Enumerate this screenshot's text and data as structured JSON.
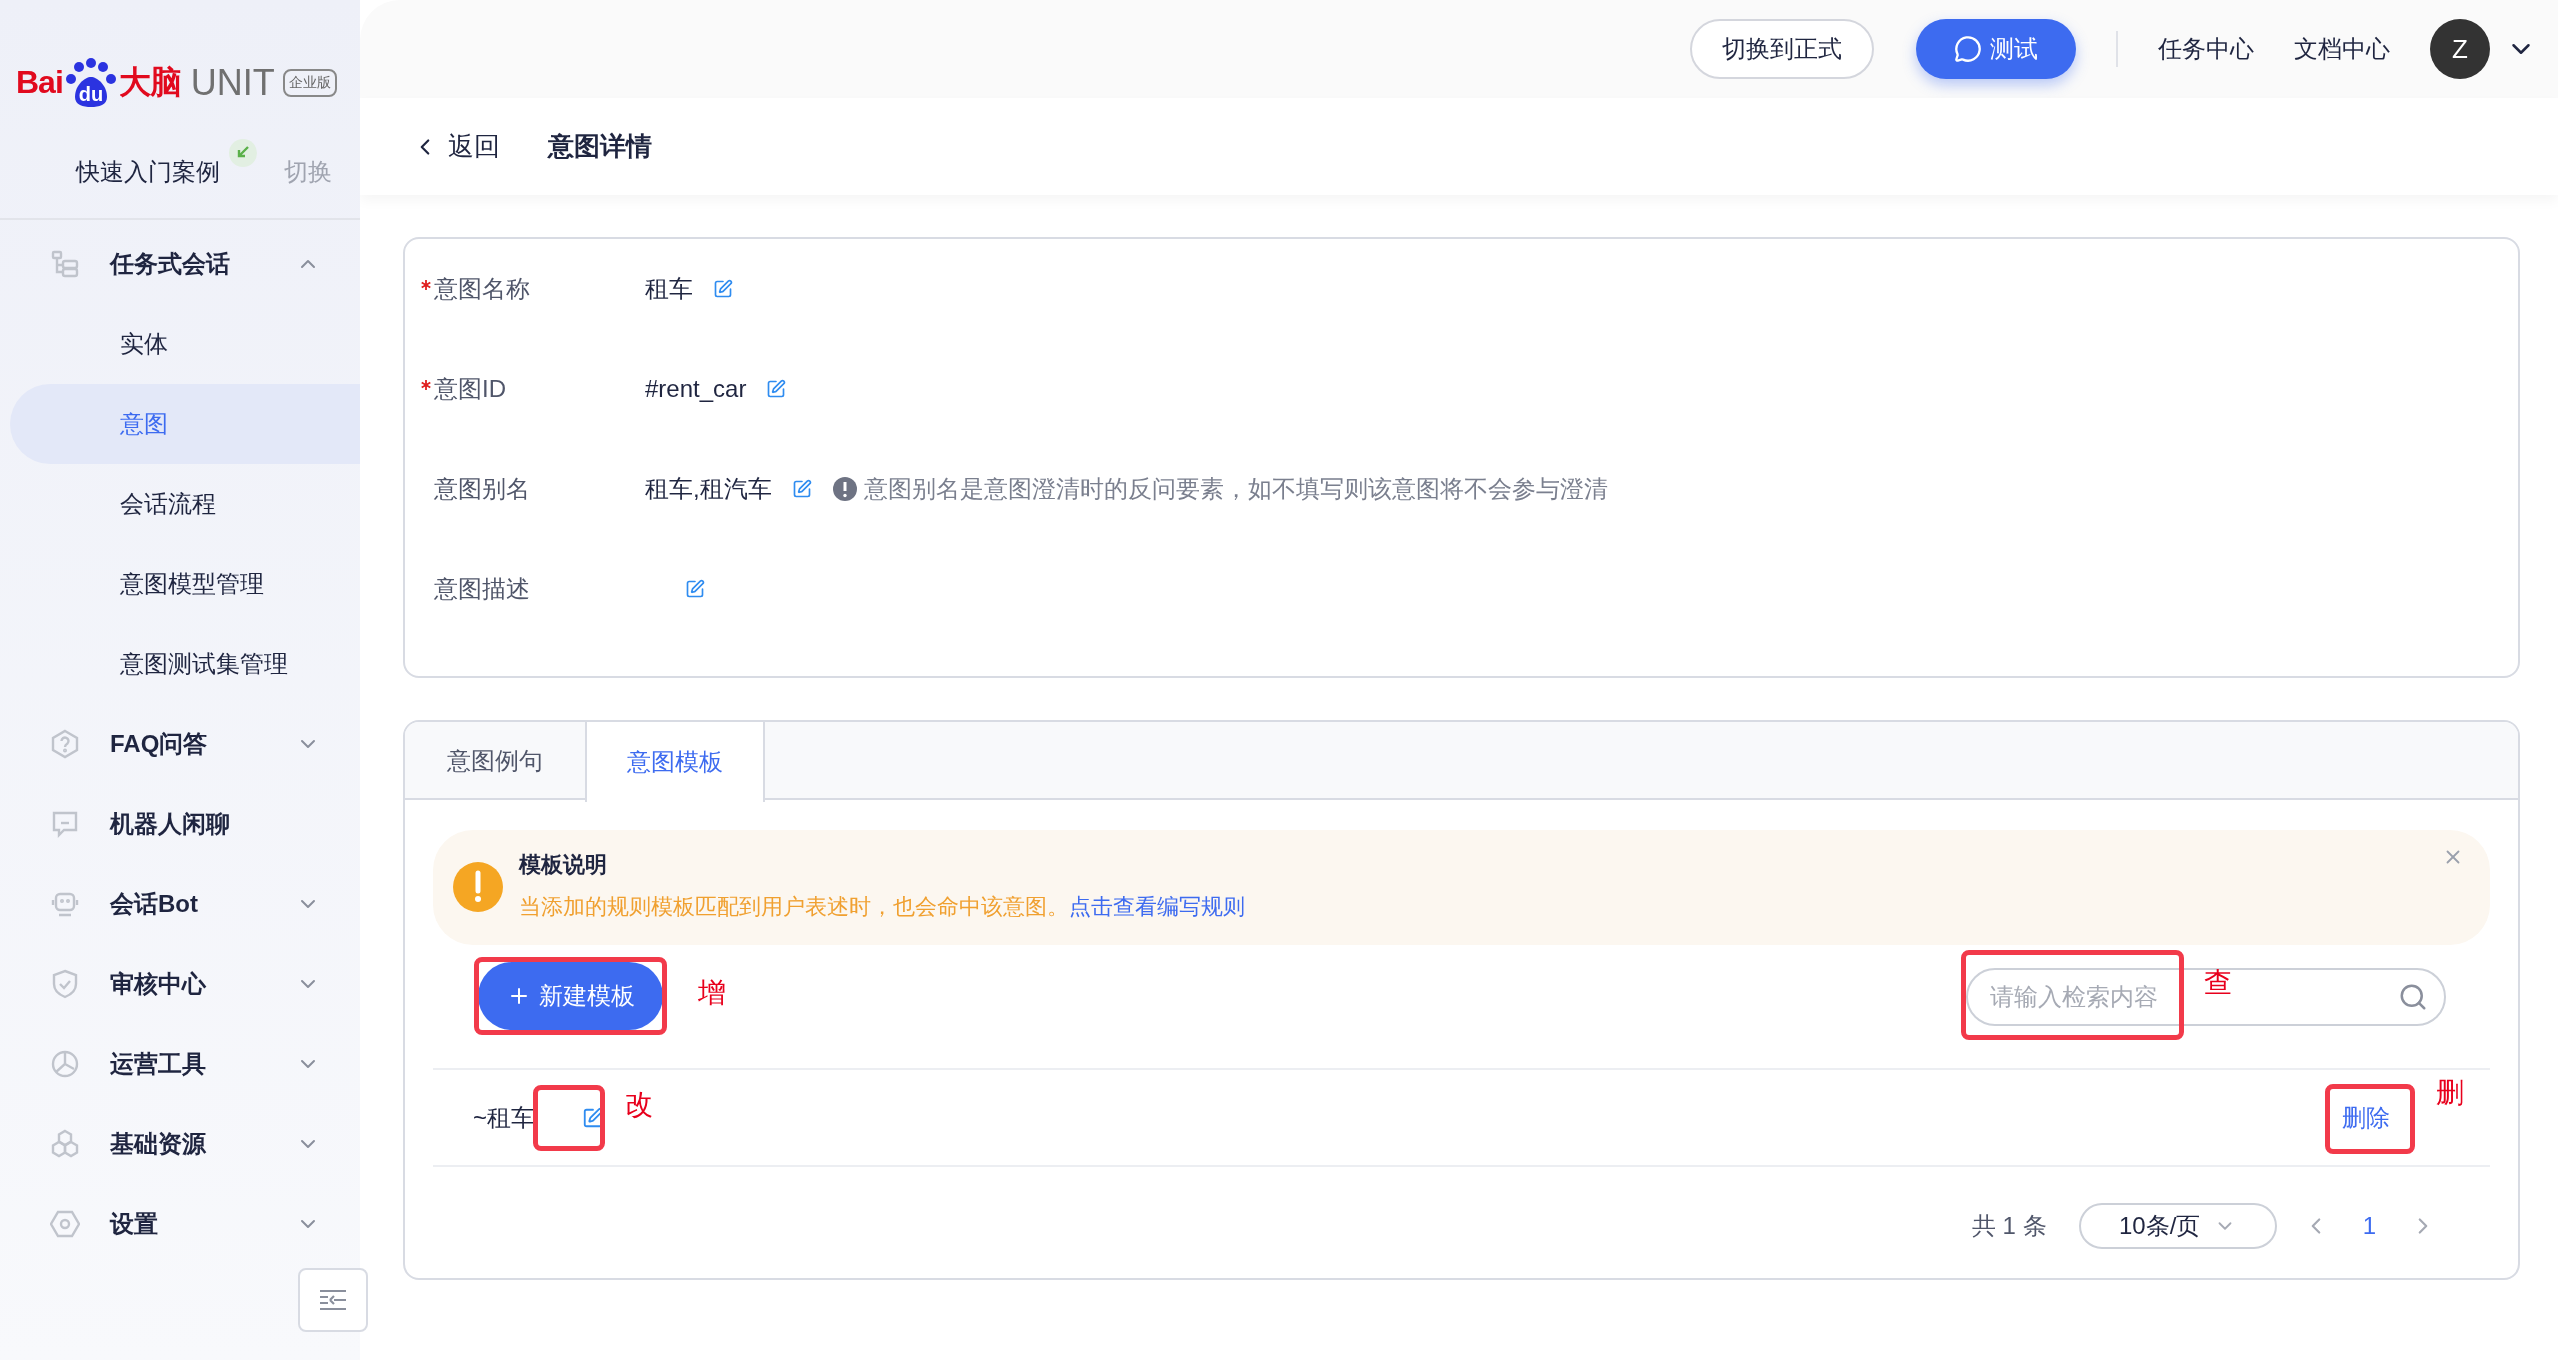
{
  "logo": {
    "brand": "Bai",
    "paw": "du",
    "suffix": "大脑",
    "product": "UNIT",
    "edition": "企业版"
  },
  "project": {
    "name": "快速入门案例",
    "switch": "切换"
  },
  "sidebar": {
    "items": [
      {
        "label": "任务式会话",
        "kind": "group",
        "expanded": true,
        "children": [
          {
            "label": "实体",
            "selected": false
          },
          {
            "label": "意图",
            "selected": true
          },
          {
            "label": "会话流程",
            "selected": false
          },
          {
            "label": "意图模型管理",
            "selected": false
          },
          {
            "label": "意图测试集管理",
            "selected": false
          }
        ]
      },
      {
        "label": "FAQ问答",
        "kind": "group",
        "expanded": false
      },
      {
        "label": "机器人闲聊",
        "kind": "link"
      },
      {
        "label": "会话Bot",
        "kind": "group",
        "expanded": false
      },
      {
        "label": "审核中心",
        "kind": "group",
        "expanded": false
      },
      {
        "label": "运营工具",
        "kind": "group",
        "expanded": false
      },
      {
        "label": "基础资源",
        "kind": "group",
        "expanded": false
      },
      {
        "label": "设置",
        "kind": "group",
        "expanded": false
      }
    ]
  },
  "topbar": {
    "switch_button": "切换到正式",
    "test_button": "测试",
    "links": [
      "任务中心",
      "文档中心"
    ],
    "avatar": "Z"
  },
  "header": {
    "back": "返回",
    "title": "意图详情"
  },
  "form": {
    "fields": [
      {
        "label": "意图名称",
        "required": true,
        "value": "租车"
      },
      {
        "label": "意图ID",
        "required": true,
        "value": "#rent_car"
      },
      {
        "label": "意图别名",
        "required": false,
        "value": "租车,租汽车",
        "hint": "意图别名是意图澄清时的反问要素，如不填写则该意图将不会参与澄清"
      },
      {
        "label": "意图描述",
        "required": false
      }
    ]
  },
  "tabs": [
    {
      "label": "意图例句",
      "selected": false
    },
    {
      "label": "意图模板",
      "selected": true
    }
  ],
  "notice": {
    "title": "模板说明",
    "text": "当添加的规则模板匹配到用户表述时，也会命中该意图。",
    "link": "点击查看编写规则"
  },
  "new_button": {
    "label": "新建模板",
    "annotation": "增"
  },
  "search": {
    "placeholder": "请输入检索内容",
    "annotation": "查"
  },
  "templates": [
    {
      "text": "~租车",
      "edit_annotation": "改",
      "action": "删除",
      "action_annotation": "删"
    }
  ],
  "pagination": {
    "total": "共 1 条",
    "page_size": "10条/页",
    "pages": [
      {
        "label": "1",
        "selected": true
      }
    ]
  }
}
